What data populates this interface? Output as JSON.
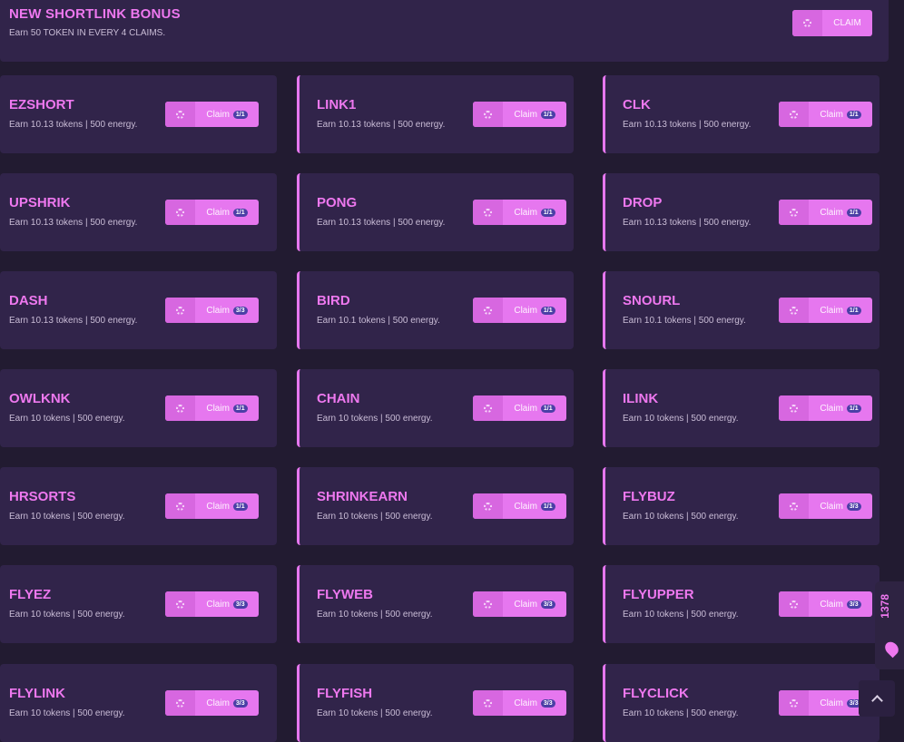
{
  "bonus": {
    "title": "NEW SHORTLINK BONUS",
    "subtitle": "Earn 50 TOKEN IN EVERY 4 CLAIMS.",
    "claim_label": "CLAIM"
  },
  "claim_label": "Claim",
  "links": [
    {
      "name": "EZSHORT",
      "desc": "Earn 10.13 tokens | 500 energy.",
      "badge": "1/1"
    },
    {
      "name": "LINK1",
      "desc": "Earn 10.13 tokens | 500 energy.",
      "badge": "1/1"
    },
    {
      "name": "CLK",
      "desc": "Earn 10.13 tokens | 500 energy.",
      "badge": "1/1"
    },
    {
      "name": "UPSHRIK",
      "desc": "Earn 10.13 tokens | 500 energy.",
      "badge": "1/1"
    },
    {
      "name": "PONG",
      "desc": "Earn 10.13 tokens | 500 energy.",
      "badge": "1/1"
    },
    {
      "name": "DROP",
      "desc": "Earn 10.13 tokens | 500 energy.",
      "badge": "1/1"
    },
    {
      "name": "DASH",
      "desc": "Earn 10.13 tokens | 500 energy.",
      "badge": "3/3"
    },
    {
      "name": "BIRD",
      "desc": "Earn 10.1 tokens | 500 energy.",
      "badge": "1/1"
    },
    {
      "name": "SNOURL",
      "desc": "Earn 10.1 tokens | 500 energy.",
      "badge": "1/1"
    },
    {
      "name": "OWLKNK",
      "desc": "Earn 10 tokens | 500 energy.",
      "badge": "1/1"
    },
    {
      "name": "CHAIN",
      "desc": "Earn 10 tokens | 500 energy.",
      "badge": "1/1"
    },
    {
      "name": "ILINK",
      "desc": "Earn 10 tokens | 500 energy.",
      "badge": "1/1"
    },
    {
      "name": "HRSORTS",
      "desc": "Earn 10 tokens | 500 energy.",
      "badge": "1/1"
    },
    {
      "name": "SHRINKEARN",
      "desc": "Earn 10 tokens | 500 energy.",
      "badge": "1/1"
    },
    {
      "name": "FLYBUZ",
      "desc": "Earn 10 tokens | 500 energy.",
      "badge": "3/3"
    },
    {
      "name": "FLYEZ",
      "desc": "Earn 10 tokens | 500 energy.",
      "badge": "3/3"
    },
    {
      "name": "FLYWEB",
      "desc": "Earn 10 tokens | 500 energy.",
      "badge": "3/3"
    },
    {
      "name": "FLYUPPER",
      "desc": "Earn 10 tokens | 500 energy.",
      "badge": "3/3"
    },
    {
      "name": "FLYLINK",
      "desc": "Earn 10 tokens | 500 energy.",
      "badge": "3/3"
    },
    {
      "name": "FLYFISH",
      "desc": "Earn 10 tokens | 500 energy.",
      "badge": "3/3"
    },
    {
      "name": "FLYCLICK",
      "desc": "Earn 10 tokens | 500 energy.",
      "badge": "3/3"
    }
  ],
  "side_widget": {
    "count": "1378",
    "icon": "drop-icon"
  },
  "scroll_top": {
    "icon": "chevron-up-icon"
  },
  "colors": {
    "accent": "#e677ef",
    "title": "#ee78ef",
    "card": "#31244a",
    "background": "#221b31",
    "badge": "#4b3fa6"
  }
}
